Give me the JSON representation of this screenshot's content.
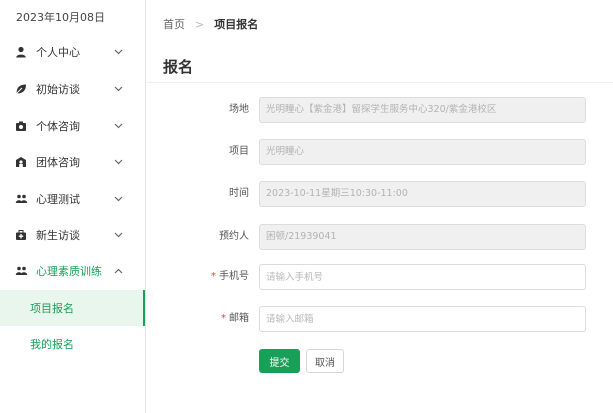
{
  "sidebar": {
    "date": "2023年10月08日",
    "menu": [
      {
        "label": "个人中心",
        "icon": "user-icon"
      },
      {
        "label": "初始访谈",
        "icon": "leaf-icon"
      },
      {
        "label": "个体咨询",
        "icon": "camera-icon"
      },
      {
        "label": "团体咨询",
        "icon": "group-icon"
      },
      {
        "label": "心理测试",
        "icon": "people-icon"
      },
      {
        "label": "新生访谈",
        "icon": "medical-bag-icon"
      },
      {
        "label": "心理素质训练",
        "icon": "people-icon",
        "expanded": true
      }
    ],
    "submenu": [
      {
        "label": "项目报名",
        "selected": true
      },
      {
        "label": "我的报名",
        "selected": false
      }
    ]
  },
  "breadcrumb": {
    "home": "首页",
    "separator": ">",
    "current": "项目报名"
  },
  "page_title": "报名",
  "form": {
    "venue": {
      "label": "场地",
      "value": "光明瞳心【紫金港】留探学生服务中心320/紫金港校区"
    },
    "project": {
      "label": "项目",
      "value": "光明瞳心"
    },
    "time": {
      "label": "时间",
      "value": "2023-10-11星期三10:30-11:00"
    },
    "booker": {
      "label": "预约人",
      "value": "困顿/21939041"
    },
    "phone": {
      "label": "手机号",
      "required_mark": "*",
      "placeholder": "请输入手机号"
    },
    "email": {
      "label": "邮箱",
      "required_mark": "*",
      "placeholder": "请输入邮箱"
    }
  },
  "buttons": {
    "submit": "提交",
    "cancel": "取消"
  },
  "colors": {
    "accent": "#18a058",
    "required": "#e0443e"
  }
}
